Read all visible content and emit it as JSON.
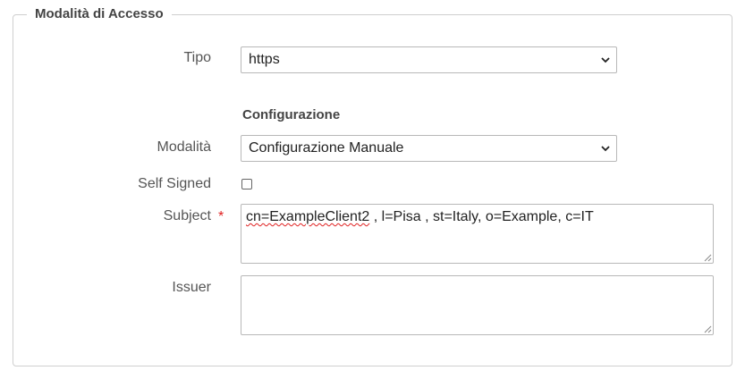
{
  "fieldset": {
    "legend": "Modalità di Accesso"
  },
  "tipo": {
    "label": "Tipo",
    "value": "https"
  },
  "configurazione": {
    "title": "Configurazione"
  },
  "modalita": {
    "label": "Modalità",
    "value": "Configurazione Manuale"
  },
  "self_signed": {
    "label": "Self Signed",
    "checked": false
  },
  "subject": {
    "label": "Subject",
    "required_marker": "*",
    "value_part1": "cn=ExampleClient2",
    "value_part2": " , l=Pisa , st=Italy, o=Example, c=IT"
  },
  "issuer": {
    "label": "Issuer",
    "value": ""
  },
  "colors": {
    "required": "#e02020",
    "border": "#cfcfcf"
  }
}
